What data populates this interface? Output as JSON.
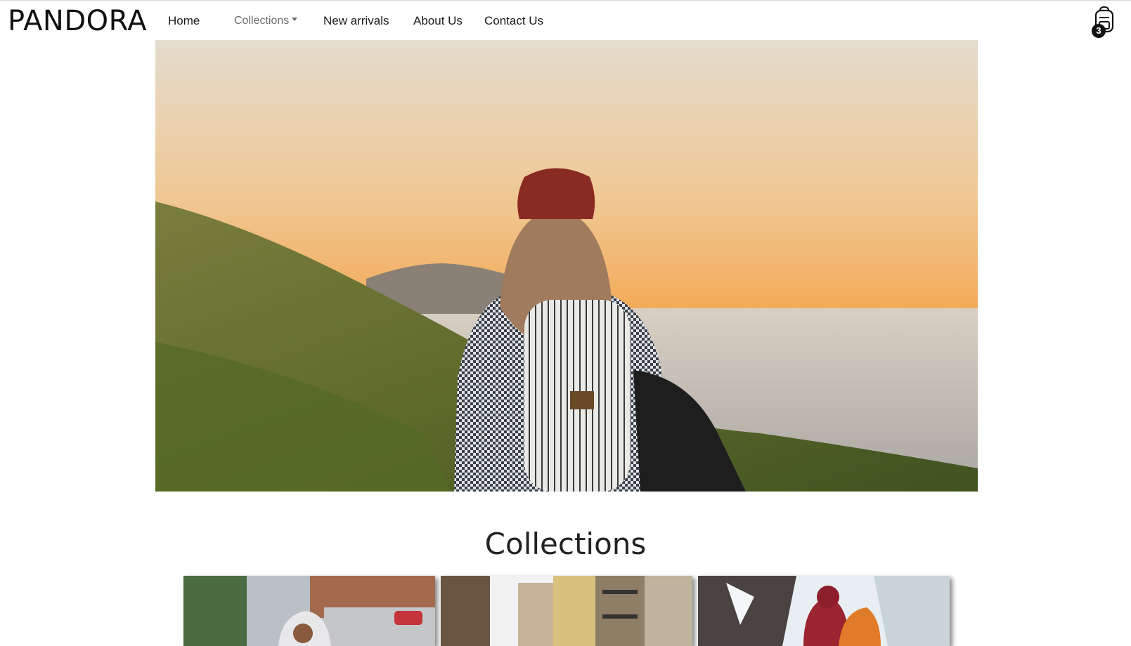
{
  "brand": {
    "name": "PANDORA"
  },
  "nav": {
    "home": "Home",
    "collections": "Collections",
    "new_arrivals": "New arrivals",
    "about": "About Us",
    "contact": "Contact Us"
  },
  "cart": {
    "count": "3",
    "icon": "backpack-icon"
  },
  "hero": {
    "image": "traveler-with-backpack-at-sunset-photo"
  },
  "collections": {
    "title": "Collections",
    "cards": [
      {
        "image": "woman-on-city-street-photo"
      },
      {
        "image": "european-street-buildings-photo"
      },
      {
        "image": "climbers-on-snowy-mountain-photo"
      }
    ]
  },
  "colors": {
    "sky_top": "#e9dcc9",
    "sky_sunset": "#f0a64f",
    "hill": "#5d6a2c",
    "sea": "#c9c3bc",
    "beanie": "#8a2b23"
  }
}
